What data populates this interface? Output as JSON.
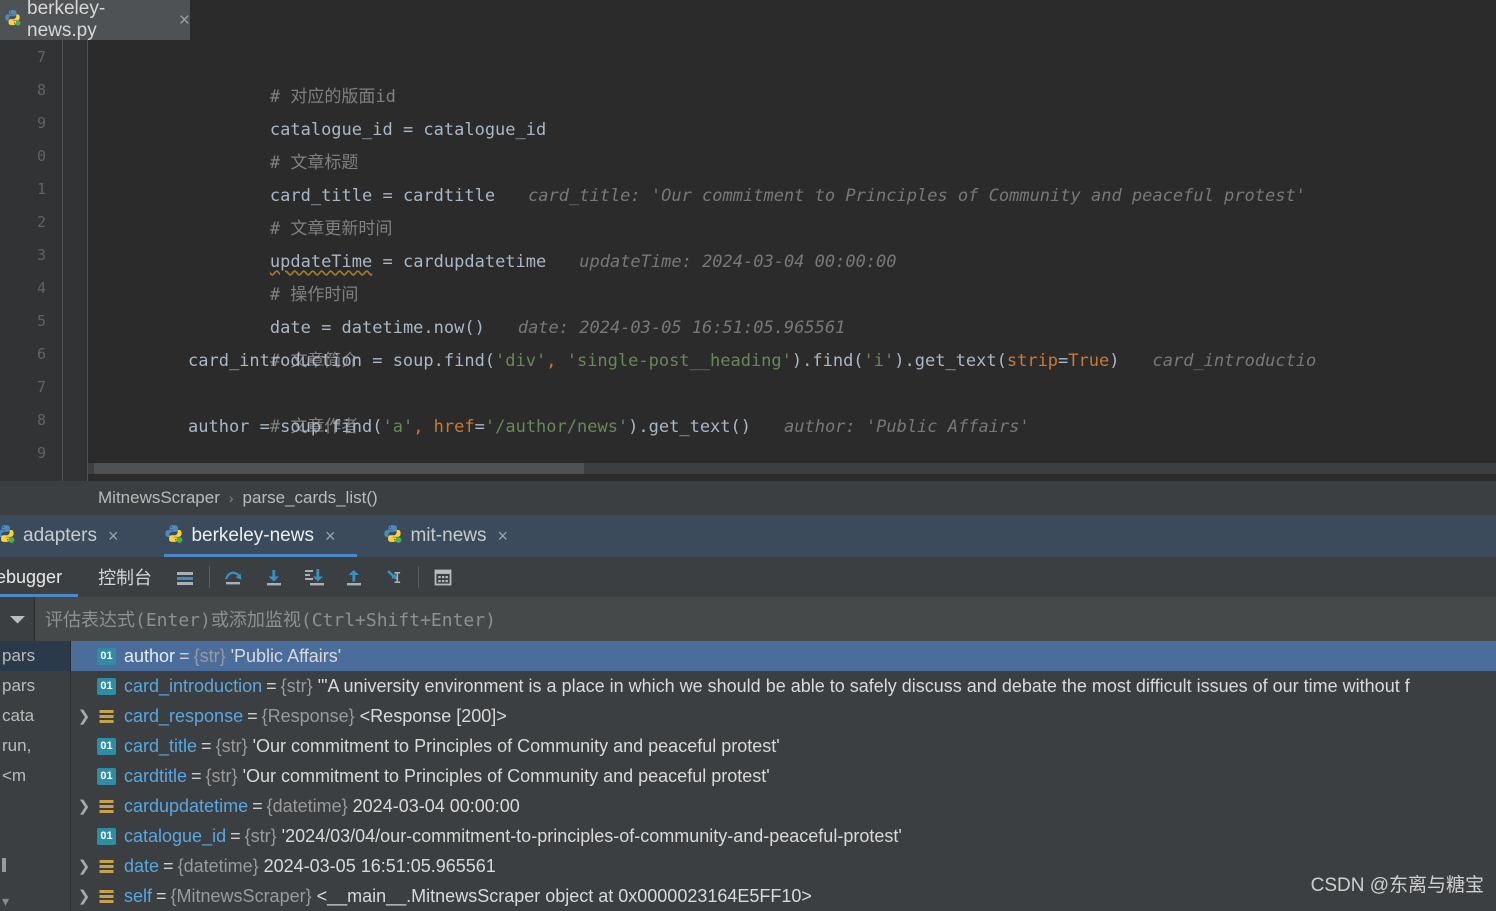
{
  "file_tab": {
    "name": "berkeley-news.py",
    "close": "×",
    "icon": "python-file-icon"
  },
  "editor": {
    "line_numbers": [
      "7",
      "8",
      "9",
      "0",
      "1",
      "2",
      "3",
      "4",
      "5",
      "6",
      "7",
      "8",
      "9"
    ],
    "lines": [
      {
        "kind": "comment",
        "text": "# 对应的版面id"
      },
      {
        "kind": "code",
        "text": "catalogue_id = catalogue_id",
        "hint": ""
      },
      {
        "kind": "comment",
        "text": "# 文章标题"
      },
      {
        "kind": "code",
        "text": "card_title = cardtitle",
        "hint": "card_title: 'Our commitment to Principles of Community and peaceful protest'"
      },
      {
        "kind": "comment",
        "text": "# 文章更新时间"
      },
      {
        "kind": "code",
        "text": "updateTime = cardupdatetime",
        "hint": "updateTime: 2024-03-04 00:00:00"
      },
      {
        "kind": "comment",
        "text": "# 操作时间"
      },
      {
        "kind": "code",
        "text": "date = datetime.now()",
        "hint": "date: 2024-03-05 16:51:05.965561"
      },
      {
        "kind": "comment",
        "text": "# 文章简介"
      },
      {
        "kind": "code",
        "text": "card_introduction = soup.find('div', 'single-post__heading').find('i').get_text(strip=True)",
        "hint": "card_introductio"
      },
      {
        "kind": "comment",
        "text": "# 文章作者"
      },
      {
        "kind": "code",
        "text": "author = soup.find('a', href='/author/news').get_text()",
        "hint": "author: 'Public Affairs'"
      }
    ],
    "code_parts": {
      "l2_a": "catalogue_id = catalogue_id",
      "l4_a": "card_title = cardtitle",
      "l4_hint": "card_title: 'Our commitment to Principles of Community and peaceful protest'",
      "l6_a": "updateTime",
      "l6_b": " = cardupdatetime",
      "l6_hint": "updateTime: 2024-03-04 00:00:00",
      "l8_a": "date = datetime.now()",
      "l8_hint": "date: 2024-03-05 16:51:05.965561",
      "l10_a": "card_introduction = soup.find(",
      "l10_s1": "'div'",
      "l10_c1": ",",
      "l10_s2": " 'single-post__heading'",
      "l10_a2": ").find(",
      "l10_s3": "'i'",
      "l10_a3": ").get_text(",
      "l10_kw": "strip",
      "l10_eq": "=",
      "l10_kw2": "True",
      "l10_a4": ")",
      "l10_hint": "card_introductio",
      "l12_a": "author = soup.find(",
      "l12_s1": "'a'",
      "l12_c1": ",",
      "l12_kw": " href",
      "l12_eq": "=",
      "l12_s2": "'/author/news'",
      "l12_a2": ").get_text()",
      "l12_hint": "author: 'Public Affairs'"
    }
  },
  "breadcrumb": {
    "class_name": "MitnewsScraper",
    "separator": "›",
    "method_name": "parse_cards_list()"
  },
  "run_tabs": [
    {
      "label": "adapters",
      "close": "×",
      "active": false,
      "icon": "python-run-icon"
    },
    {
      "label": "berkeley-news",
      "close": "×",
      "active": true,
      "icon": "python-run-icon"
    },
    {
      "label": "mit-news",
      "close": "×",
      "active": false,
      "icon": "python-run-icon"
    }
  ],
  "debug_toolbar": {
    "tab_debugger": "ebugger",
    "tab_console": "控制台",
    "icons": [
      "show-execution-point-icon",
      "step-over-icon",
      "step-into-icon",
      "force-step-into-icon",
      "step-out-icon",
      "run-to-cursor-icon",
      "evaluate-expression-icon"
    ]
  },
  "watch": {
    "chevron": "▼",
    "placeholder": "评估表达式(Enter)或添加监视(Ctrl+Shift+Enter)"
  },
  "frames": [
    {
      "text": "pars",
      "selected": true
    },
    {
      "text": "pars",
      "selected": false
    },
    {
      "text": "cata",
      "selected": false
    },
    {
      "text": "run,",
      "selected": false
    },
    {
      "text": "<m",
      "selected": false
    }
  ],
  "variables": [
    {
      "expandable": false,
      "badge": "01",
      "badge_kind": "prim",
      "selected": true,
      "name": "author",
      "type": "{str}",
      "value": "'Public Affairs'"
    },
    {
      "expandable": false,
      "badge": "01",
      "badge_kind": "prim",
      "selected": false,
      "name": "card_introduction",
      "type": "{str}",
      "value": "'\"A university environment is a place in which we should be able to safely discuss and debate the most difficult issues of our time without f"
    },
    {
      "expandable": true,
      "badge": "list",
      "badge_kind": "obj",
      "selected": false,
      "name": "card_response",
      "type": "{Response}",
      "value": "<Response [200]>"
    },
    {
      "expandable": false,
      "badge": "01",
      "badge_kind": "prim",
      "selected": false,
      "name": "card_title",
      "type": "{str}",
      "value": "'Our commitment to Principles of Community and peaceful protest'"
    },
    {
      "expandable": false,
      "badge": "01",
      "badge_kind": "prim",
      "selected": false,
      "name": "cardtitle",
      "type": "{str}",
      "value": "'Our commitment to Principles of Community and peaceful protest'"
    },
    {
      "expandable": true,
      "badge": "list",
      "badge_kind": "obj",
      "selected": false,
      "name": "cardupdatetime",
      "type": "{datetime}",
      "value": "2024-03-04 00:00:00"
    },
    {
      "expandable": false,
      "badge": "01",
      "badge_kind": "prim",
      "selected": false,
      "name": "catalogue_id",
      "type": "{str}",
      "value": "'2024/03/04/our-commitment-to-principles-of-community-and-peaceful-protest'"
    },
    {
      "expandable": true,
      "badge": "list",
      "badge_kind": "obj",
      "selected": false,
      "name": "date",
      "type": "{datetime}",
      "value": "2024-03-05 16:51:05.965561"
    },
    {
      "expandable": true,
      "badge": "list",
      "badge_kind": "obj",
      "selected": false,
      "name": "self",
      "type": "{MitnewsScraper}",
      "value": "<__main__.MitnewsScraper object at 0x0000023164E5FF10>"
    }
  ],
  "watermark": "CSDN @东离与糖宝",
  "colors": {
    "editor_bg": "#2b2b2b",
    "panel_bg": "#3c3f41",
    "tabs_bg": "#3c4b5c",
    "accent": "#4a88c7",
    "selection": "#4a6d9c",
    "string": "#6a8759",
    "keyword": "#cc7832",
    "comment": "#808080",
    "default_text": "#a9b7c6",
    "hint": "#787878",
    "var_name": "#5aa7e0"
  }
}
